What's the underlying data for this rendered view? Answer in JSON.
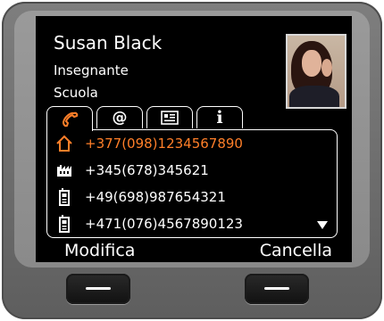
{
  "contact": {
    "name": "Susan Black",
    "line1": "Insegnante",
    "line2": "Scuola"
  },
  "tabs": [
    {
      "icon": "phone-handset-icon",
      "active": true
    },
    {
      "icon": "at-icon",
      "label": "@"
    },
    {
      "icon": "vcard-icon"
    },
    {
      "icon": "info-icon",
      "label": "i"
    }
  ],
  "numbers": [
    {
      "icon": "home-icon",
      "number": "+377(098)1234567890",
      "selected": true
    },
    {
      "icon": "office-building-icon",
      "number": "+345(678)345621"
    },
    {
      "icon": "mobile-phone-icon",
      "number": "+49(698)987654321"
    },
    {
      "icon": "mobile-phone-icon",
      "number": "+471(076)4567890123"
    }
  ],
  "softkeys": {
    "left_label": "Modifica",
    "right_label": "Cancella"
  },
  "colors": {
    "accent": "#ff7f29",
    "screen_bg": "#000000",
    "text": "#ffffff",
    "bezel": "#7a7a7a"
  }
}
